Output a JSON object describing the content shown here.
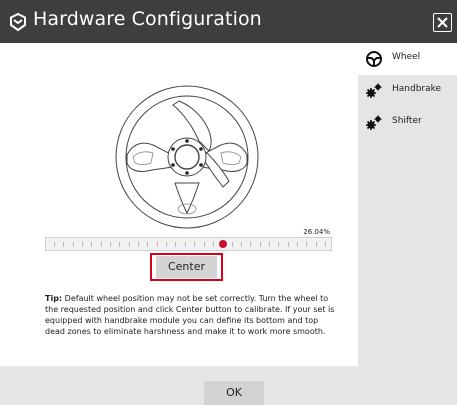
{
  "window": {
    "title": "Hardware Configuration",
    "title_bar_color": "#3e3e3e",
    "close_icon": "close-icon"
  },
  "sidebar": {
    "items": [
      {
        "label": "Wheel",
        "icon": "steering-wheel-icon",
        "active": true
      },
      {
        "label": "Handbrake",
        "icon": "gears-icon",
        "active": false
      },
      {
        "label": "Shifter",
        "icon": "gears-icon",
        "active": false
      }
    ]
  },
  "main": {
    "slider_percent_label": "26.04%",
    "slider_position_fraction": 0.62,
    "center_button_label": "Center",
    "tip_bold": "Tip:",
    "tip_text": " Default wheel position may not be set correctly. Turn the wheel to the requested position and click Center button to calibrate. If your set is equipped with handbrake module you can define its bottom and top dead zones to eliminate harshness and make it to work more smooth."
  },
  "footer": {
    "ok_label": "OK"
  },
  "colors": {
    "accent_red": "#d9001b",
    "sidebar_bg": "#e5e5e5"
  }
}
